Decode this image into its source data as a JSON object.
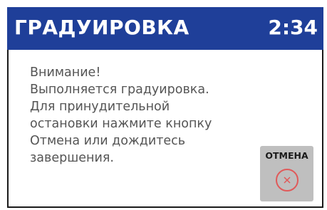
{
  "header": {
    "title": "ГРАДУИРОВКА",
    "time": "2:34",
    "background_color": "#1f3f99"
  },
  "message": {
    "lines": [
      "Внимание!",
      "Выполняется градуировка.",
      "Для принудительной",
      "остановки нажмите кнопку",
      "Отмена или дождитесь",
      "завершения."
    ]
  },
  "cancel_button": {
    "label": "ОТМЕНА",
    "icon": "close-circle-icon",
    "icon_color": "#e05a5a",
    "background_color": "#bfbfbf"
  }
}
